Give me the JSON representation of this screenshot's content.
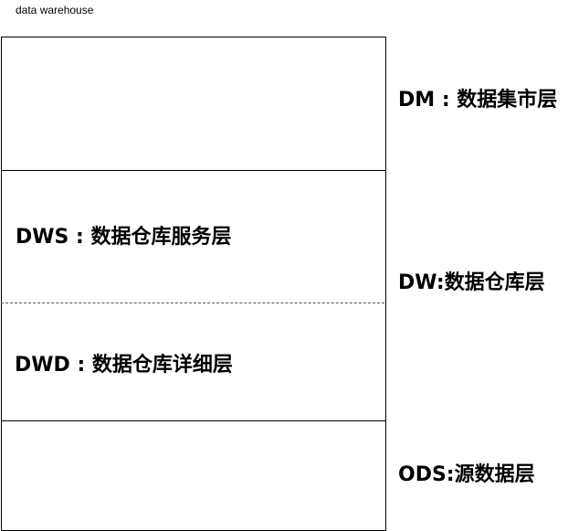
{
  "title": "data warehouse",
  "layers": {
    "dm": "DM : 数据集市层",
    "dw": "DW:数据仓库层",
    "dws": "DWS : 数据仓库服务层",
    "dwd": "DWD : 数据仓库详细层",
    "ods": "ODS:源数据层"
  },
  "colors": {
    "border": "#000000",
    "dashed_divider": "#555555",
    "background": "#ffffff"
  }
}
